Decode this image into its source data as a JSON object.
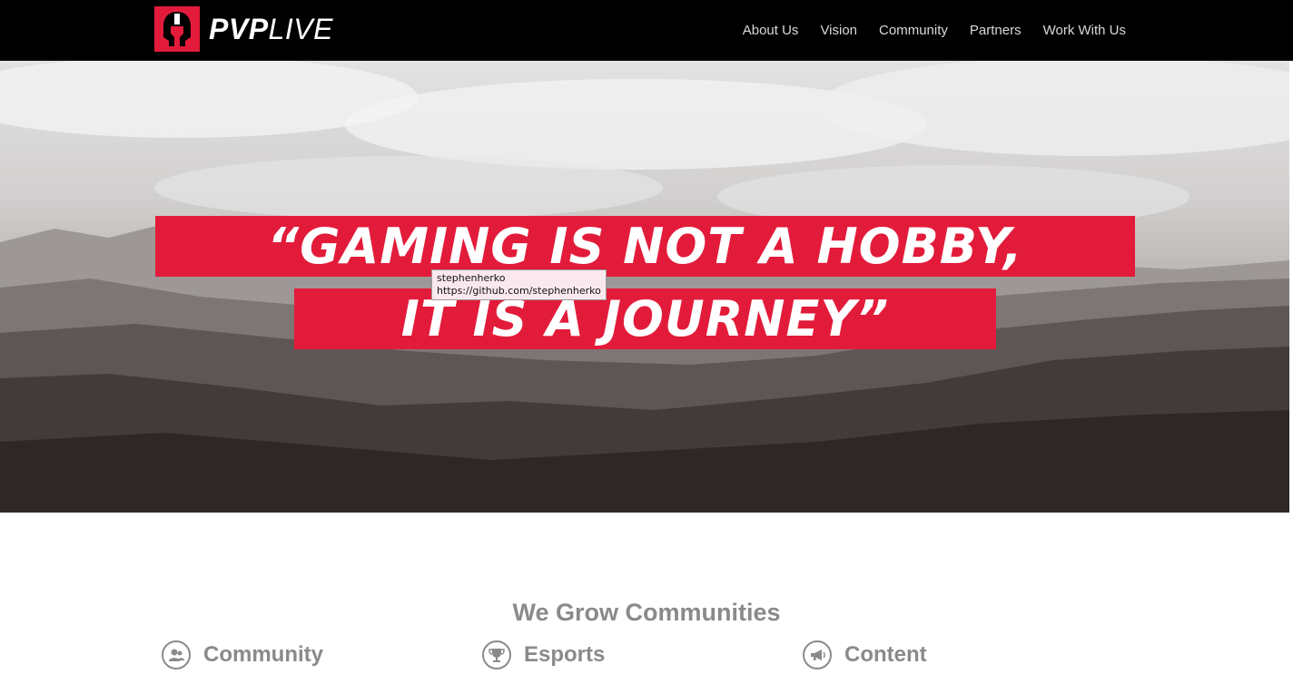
{
  "brand": {
    "bold": "PVP",
    "light": "LIVE",
    "color": "#e31b3a"
  },
  "nav": [
    "About Us",
    "Vision",
    "Community",
    "Partners",
    "Work With Us"
  ],
  "hero": {
    "line1": "“GAMING IS NOT A HOBBY,",
    "line2": "IT IS A JOURNEY”"
  },
  "tooltip": {
    "line1": "stephenherko",
    "line2": "https://github.com/stephenherko"
  },
  "section": {
    "title": "We Grow Communities",
    "features": [
      {
        "label": "Community",
        "icon": "users-icon"
      },
      {
        "label": "Esports",
        "icon": "trophy-icon"
      },
      {
        "label": "Content",
        "icon": "megaphone-icon"
      }
    ]
  }
}
